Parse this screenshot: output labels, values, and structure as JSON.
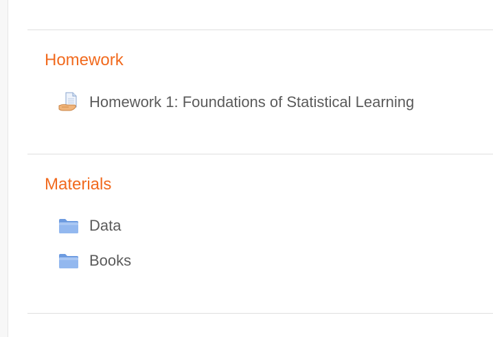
{
  "sections": [
    {
      "title": "Homework",
      "items": [
        {
          "label": "Homework 1: Foundations of Statistical Learning",
          "icon": "assignment-icon"
        }
      ]
    },
    {
      "title": "Materials",
      "items": [
        {
          "label": "Data",
          "icon": "folder-icon"
        },
        {
          "label": "Books",
          "icon": "folder-icon"
        }
      ]
    }
  ],
  "colors": {
    "section_title": "#f16a1e",
    "item_text": "#5a5a5a",
    "divider": "#dedede",
    "folder": "#7fa8e8"
  }
}
